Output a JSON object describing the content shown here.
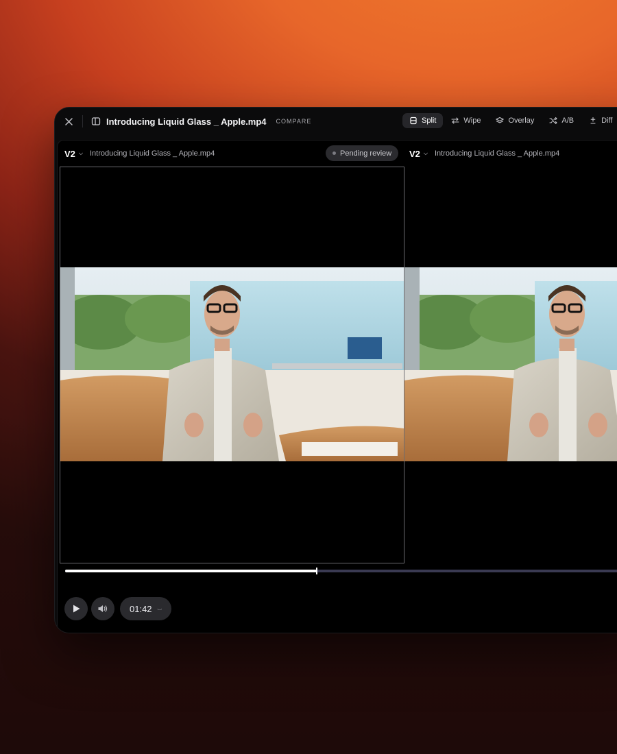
{
  "window": {
    "file_title": "Introducing Liquid Glass _ Apple.mp4",
    "compare_label": "COMPARE"
  },
  "modes": [
    {
      "label": "Split",
      "icon": "split-icon",
      "active": true
    },
    {
      "label": "Wipe",
      "icon": "wipe-arrows-icon",
      "active": false
    },
    {
      "label": "Overlay",
      "icon": "layers-icon",
      "active": false
    },
    {
      "label": "A/B",
      "icon": "shuffle-icon",
      "active": false
    },
    {
      "label": "Diff",
      "icon": "plus-minus-icon",
      "active": false
    }
  ],
  "left_pane": {
    "version": "V2",
    "file_name": "Introducing Liquid Glass _ Apple.mp4",
    "status": "Pending review"
  },
  "right_pane": {
    "version": "V2",
    "file_name": "Introducing Liquid Glass _ Apple.mp4"
  },
  "playback": {
    "progress": 0.427,
    "time": "01:42"
  },
  "colors": {
    "accent_orange": "#e7662a",
    "window_bg": "#0b0b0c",
    "progress_track": "#3a3a52"
  }
}
